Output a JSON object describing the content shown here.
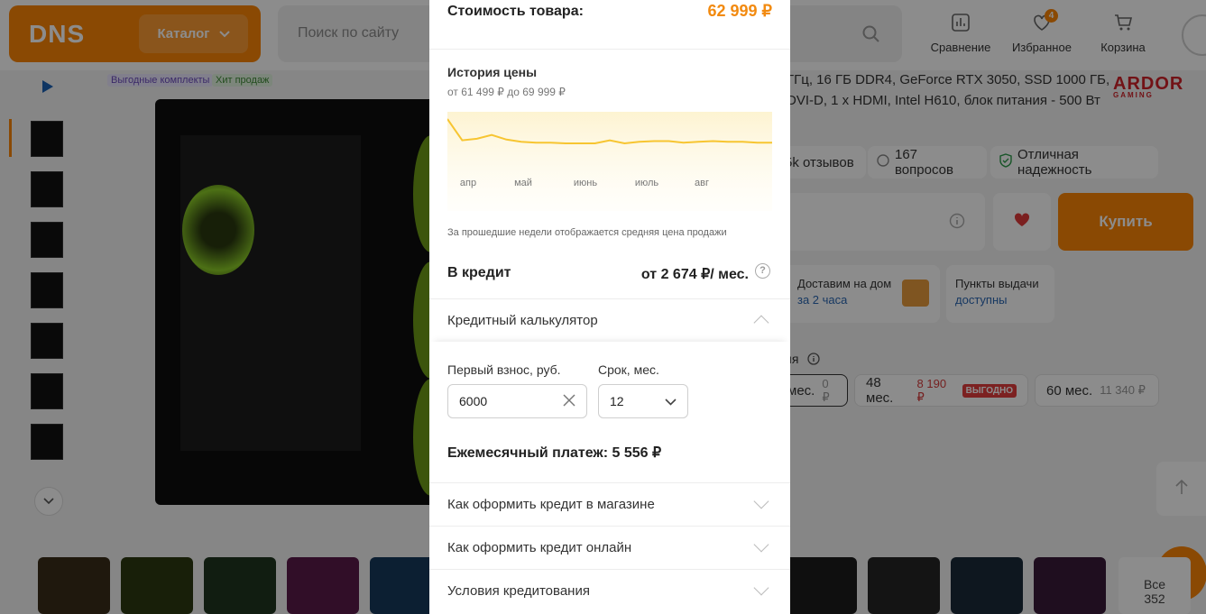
{
  "header": {
    "logo": "DNS",
    "catalog_label": "Каталог",
    "search_placeholder": "Поиск по сайту",
    "compare_label": "Сравнение",
    "favorites_label": "Избранное",
    "favorites_count": "4",
    "cart_label": "Корзина"
  },
  "product": {
    "tags": [
      "Выгодные комплекты",
      "Хит продаж"
    ],
    "title_line1": "ГГц, 16 ГБ DDR4, GeForce RTX 3050, SSD 1000 ГБ,",
    "title_line2": "DVI-D, 1 x HDMI, Intel H610, блок питания - 500 Вт",
    "brand": "ARDOR",
    "brand_sub": "GAMING",
    "reviews": "5k отзывов",
    "questions": "167 вопросов",
    "reliability": "Отличная надежность",
    "buy_label": "Купить",
    "delivery_title": "Доставим на дом",
    "delivery_time": "за 2 часа",
    "pickup_title": "Пункты выдачи",
    "pickup_status": "доступны",
    "credit_section_label": "ия",
    "credit_terms": [
      {
        "label": "мес.",
        "price": "0 ₽",
        "badge": ""
      },
      {
        "label": "48 мес.",
        "price": "8 190 ₽",
        "badge": "ВЫГОДНО"
      },
      {
        "label": "60 мес.",
        "price": "11 340 ₽",
        "badge": ""
      }
    ],
    "all_photos": "Все",
    "all_photos_count": "352"
  },
  "modal": {
    "cost_label": "Стоимость товара:",
    "cost_value": "62 999 ₽",
    "history_title": "История цены",
    "history_range": "от 61 499 ₽ до 69 999 ₽",
    "history_note": "За прошедшие недели отображается средняя цена продажи",
    "credit_label": "В кредит",
    "credit_value": "от 2 674 ₽/ мес.",
    "calculator_label": "Кредитный калькулятор",
    "down_payment_label": "Первый взнос, руб.",
    "down_payment_value": "6000",
    "term_label": "Срок, мес.",
    "term_value": "12",
    "monthly_payment": "Ежемесячный платеж: 5 556 ₽",
    "accordion": [
      "Как оформить кредит в магазине",
      "Как оформить кредит онлайн",
      "Условия кредитования"
    ]
  },
  "chart_data": {
    "type": "line",
    "x_labels": [
      "апр",
      "май",
      "июнь",
      "июль",
      "авг"
    ],
    "values": [
      69999,
      67200,
      67400,
      67900,
      67300,
      67000,
      66900,
      66900,
      66800,
      66800,
      66800,
      67200,
      66800,
      67000,
      67100,
      67100,
      66900,
      67000,
      67100,
      67000,
      67000,
      66900,
      66900
    ],
    "color": "#f7c531"
  }
}
